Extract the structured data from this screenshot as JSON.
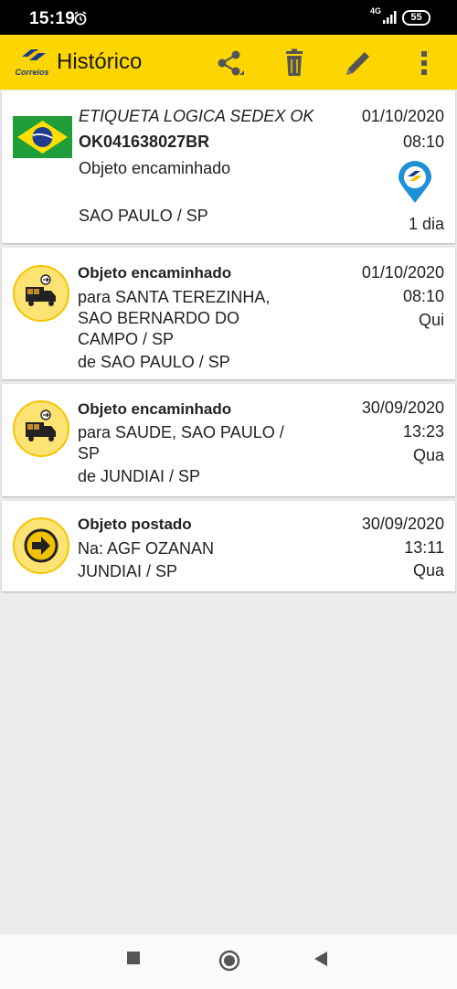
{
  "status": {
    "time": "15:19",
    "network": "4G",
    "battery": "55"
  },
  "appbar": {
    "logo_text": "Correios",
    "title": "Histórico",
    "icons": [
      "share-icon",
      "trash-icon",
      "pencil-icon",
      "more-vert-icon"
    ]
  },
  "summary": {
    "label": "ETIQUETA LOGICA SEDEX OK",
    "code": "OK041638027BR",
    "status": "Objeto encaminhado",
    "location": "SAO PAULO / SP",
    "date": "01/10/2020",
    "time": "08:10",
    "days": "1 dia"
  },
  "events": [
    {
      "icon": "truck-icon",
      "title": "Objeto encaminhado",
      "lines": [
        "para SANTA TEREZINHA,",
        "SAO BERNARDO DO",
        "CAMPO / SP",
        "de SAO PAULO / SP"
      ],
      "date": "01/10/2020",
      "time": "08:10",
      "weekday": "Qui"
    },
    {
      "icon": "truck-icon",
      "title": "Objeto encaminhado",
      "lines": [
        "para SAUDE, SAO PAULO /",
        "SP",
        "de JUNDIAI / SP"
      ],
      "date": "30/09/2020",
      "time": "13:23",
      "weekday": "Qua"
    },
    {
      "icon": "arrow-right-icon",
      "title": "Objeto postado",
      "lines": [
        "Na: AGF OZANAN",
        "JUNDIAI / SP"
      ],
      "date": "30/09/2020",
      "time": "13:11",
      "weekday": "Qua"
    }
  ],
  "colors": {
    "appbar": "#fdd500",
    "icon_bg": "#fce373",
    "brand_blue": "#1b3a8c"
  }
}
